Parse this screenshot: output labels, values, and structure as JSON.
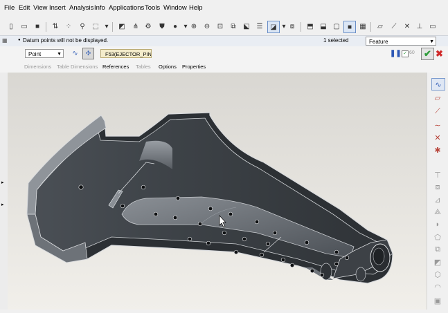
{
  "menu": [
    "File",
    "Edit",
    "View",
    "Insert",
    "Analysis",
    "Info",
    "Applications",
    "Tools",
    "Window",
    "Help"
  ],
  "message": "Datum points will not be displayed.",
  "selection": {
    "count_text": "1 selected",
    "filter_value": "Feature"
  },
  "dashboard": {
    "type_value": "Point",
    "reference_value": "F53(EJECTOR_PIN_",
    "tabs": [
      "Dimensions",
      "Table Dimensions",
      "References",
      "Tables",
      "Options",
      "Properties"
    ],
    "pause_icon": "pause-icon",
    "preview_label": "60",
    "accept_icon": "checkmark-icon",
    "cancel_icon": "x-icon"
  },
  "colors": {
    "model_dark": "#3b3f44",
    "model_light": "#9aa0a6",
    "edge": "#e9eaec",
    "accept": "#2e9b3a",
    "cancel": "#d02a2a",
    "pause": "#2d58b5"
  }
}
